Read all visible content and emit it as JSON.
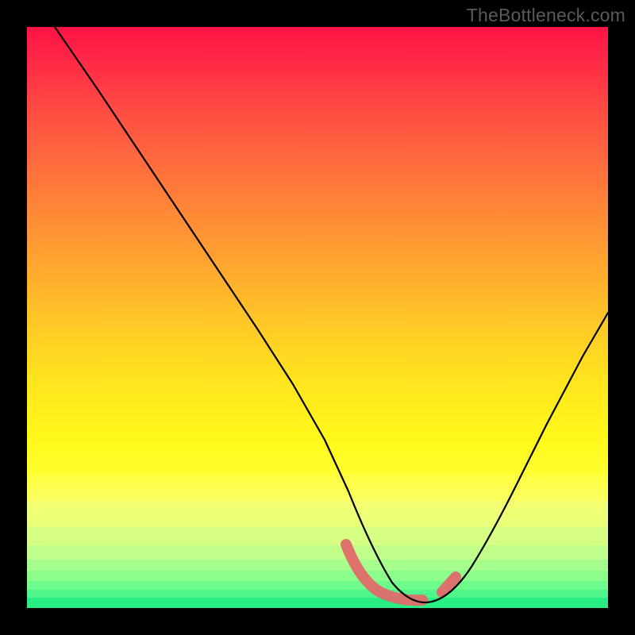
{
  "watermark": "TheBottleneck.com",
  "chart_data": {
    "type": "line",
    "title": "",
    "xlabel": "",
    "ylabel": "",
    "x_range": [
      0,
      100
    ],
    "y_range": [
      0,
      100
    ],
    "background_gradient": {
      "top_color": "#ff1345",
      "mid_color": "#ffe61e",
      "bottom_color": "#28ee84",
      "banded_bottom": true
    },
    "series": [
      {
        "name": "bottleneck-curve",
        "color": "#000000",
        "x": [
          5,
          10,
          15,
          20,
          25,
          30,
          35,
          40,
          45,
          50,
          55,
          58,
          60,
          63,
          65,
          68,
          70,
          73,
          75,
          80,
          85,
          90,
          95,
          100
        ],
        "y": [
          100,
          92,
          84,
          76,
          68,
          60,
          51,
          42,
          33,
          24,
          14,
          9,
          6,
          4,
          3,
          3,
          4,
          6,
          9,
          17,
          27,
          38,
          49,
          57
        ]
      }
    ],
    "highlight_region": {
      "name": "optimal-zone",
      "color": "#e06a6a",
      "x_start": 56,
      "x_end": 74,
      "style": "thick-with-gap"
    },
    "minimum": {
      "x": 66,
      "y": 3
    }
  }
}
